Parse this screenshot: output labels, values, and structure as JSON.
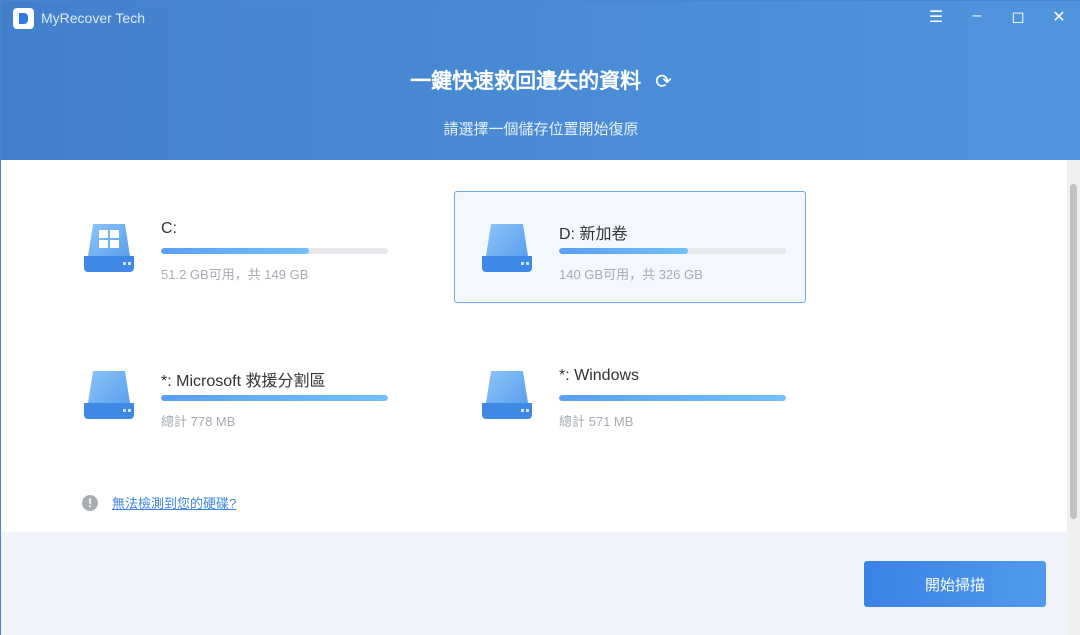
{
  "app": {
    "title": "MyRecover Tech"
  },
  "header": {
    "title": "一鍵快速救回遺失的資料",
    "subtitle": "請選擇一個儲存位置開始復原"
  },
  "drives": [
    {
      "name": "C:",
      "info": "51.2 GB可用，共 149 GB",
      "used_percent": 65,
      "windows": true,
      "selected": false
    },
    {
      "name": "D: 新加卷",
      "info": "140 GB可用，共 326 GB",
      "used_percent": 57,
      "windows": false,
      "selected": true
    },
    {
      "name": "*: Microsoft 救援分割區",
      "info": "總計 778 MB",
      "used_percent": 100,
      "windows": false,
      "selected": false
    },
    {
      "name": "*: Windows",
      "info": "總計 571 MB",
      "used_percent": 100,
      "windows": false,
      "selected": false
    }
  ],
  "help": {
    "link": "無法檢測到您的硬碟?"
  },
  "footer": {
    "scan_label": "開始掃描"
  }
}
